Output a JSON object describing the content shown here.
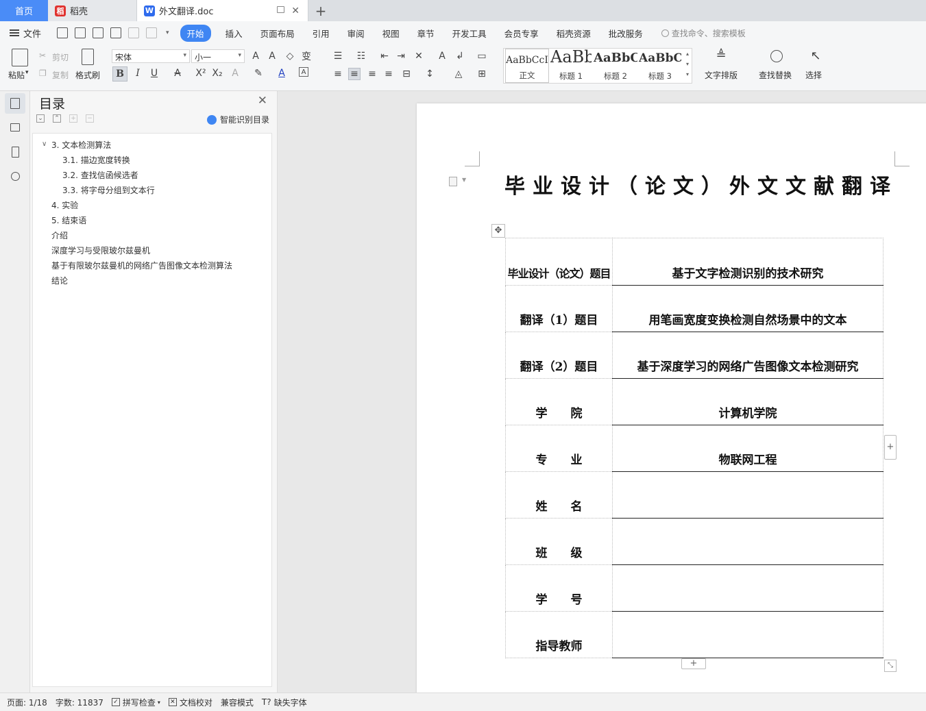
{
  "tabs": {
    "home": "首页",
    "daoke": "稻壳",
    "doc": "外文翻译.doc",
    "add": "+"
  },
  "menu": {
    "file": "文件",
    "items": [
      "开始",
      "插入",
      "页面布局",
      "引用",
      "审阅",
      "视图",
      "章节",
      "开发工具",
      "会员专享",
      "稻壳资源",
      "批改服务"
    ],
    "search": "查找命令、搜索模板"
  },
  "ribbon": {
    "paste": "粘贴",
    "cut": "剪切",
    "copy": "复制",
    "format_painter": "格式刷",
    "font": "宋体",
    "size": "小一",
    "styles": [
      {
        "sample": "AaBbCcI",
        "name": "正文"
      },
      {
        "sample": "AaBb",
        "name": "标题 1"
      },
      {
        "sample": "AaBbC",
        "name": "标题 2"
      },
      {
        "sample": "AaBbC",
        "name": "标题 3"
      }
    ],
    "text_layout": "文字排版",
    "find_replace": "查找替换",
    "select": "选择"
  },
  "toc": {
    "title": "目录",
    "smart": "智能识别目录",
    "items": [
      {
        "label": "3. 文本检测算法",
        "level": 1,
        "caret": "∨"
      },
      {
        "label": "3.1. 描边宽度转换",
        "level": 2
      },
      {
        "label": "3.2. 查找信函候选者",
        "level": 2
      },
      {
        "label": "3.3. 将字母分组到文本行",
        "level": 2
      },
      {
        "label": "4. 实验",
        "level": 1
      },
      {
        "label": "5. 结束语",
        "level": 1
      },
      {
        "label": "介绍",
        "level": 1
      },
      {
        "label": "深度学习与受限玻尔兹曼机",
        "level": 1
      },
      {
        "label": "基于有限玻尔兹曼机的网络广告图像文本检测算法",
        "level": 1
      },
      {
        "label": "结论",
        "level": 1
      }
    ]
  },
  "document": {
    "title": "毕业设计（论文）外文文献翻译",
    "rows": [
      {
        "label": "毕业设计（论文）题目",
        "value": "基于文字检测识别的技术研究"
      },
      {
        "label": "翻译（1）题目",
        "value": "用笔画宽度变换检测自然场景中的文本"
      },
      {
        "label": "翻译（2）题目",
        "value": "基于深度学习的网络广告图像文本检测研究"
      },
      {
        "label": "学　　院",
        "value": "计算机学院"
      },
      {
        "label": "专　　业",
        "value": "物联网工程"
      },
      {
        "label": "姓　　名",
        "value": ""
      },
      {
        "label": "班　　级",
        "value": ""
      },
      {
        "label": "学　　号",
        "value": ""
      },
      {
        "label": "指导教师",
        "value": ""
      }
    ]
  },
  "status": {
    "page": "页面: 1/18",
    "words": "字数: 11837",
    "spell": "拼写检查",
    "proof": "文档校对",
    "compat": "兼容模式",
    "missing_font": "缺失字体"
  },
  "colors": {
    "accent": "#3f86f3",
    "home_tab": "#4a8cf7",
    "daoke_logo": "#e0322f",
    "wps_logo": "#2f6bed"
  }
}
